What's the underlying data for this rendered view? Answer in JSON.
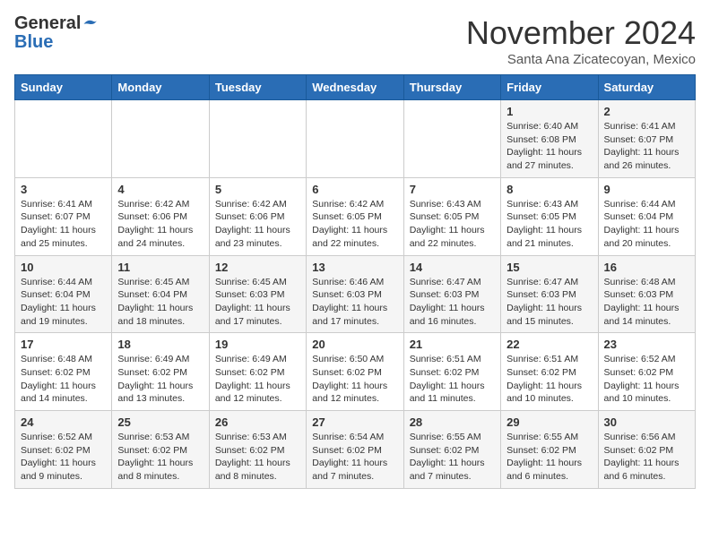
{
  "header": {
    "logo_general": "General",
    "logo_blue": "Blue",
    "month_title": "November 2024",
    "subtitle": "Santa Ana Zicatecoyan, Mexico"
  },
  "days_of_week": [
    "Sunday",
    "Monday",
    "Tuesday",
    "Wednesday",
    "Thursday",
    "Friday",
    "Saturday"
  ],
  "weeks": [
    [
      {
        "day": "",
        "info": ""
      },
      {
        "day": "",
        "info": ""
      },
      {
        "day": "",
        "info": ""
      },
      {
        "day": "",
        "info": ""
      },
      {
        "day": "",
        "info": ""
      },
      {
        "day": "1",
        "info": "Sunrise: 6:40 AM\nSunset: 6:08 PM\nDaylight: 11 hours and 27 minutes."
      },
      {
        "day": "2",
        "info": "Sunrise: 6:41 AM\nSunset: 6:07 PM\nDaylight: 11 hours and 26 minutes."
      }
    ],
    [
      {
        "day": "3",
        "info": "Sunrise: 6:41 AM\nSunset: 6:07 PM\nDaylight: 11 hours and 25 minutes."
      },
      {
        "day": "4",
        "info": "Sunrise: 6:42 AM\nSunset: 6:06 PM\nDaylight: 11 hours and 24 minutes."
      },
      {
        "day": "5",
        "info": "Sunrise: 6:42 AM\nSunset: 6:06 PM\nDaylight: 11 hours and 23 minutes."
      },
      {
        "day": "6",
        "info": "Sunrise: 6:42 AM\nSunset: 6:05 PM\nDaylight: 11 hours and 22 minutes."
      },
      {
        "day": "7",
        "info": "Sunrise: 6:43 AM\nSunset: 6:05 PM\nDaylight: 11 hours and 22 minutes."
      },
      {
        "day": "8",
        "info": "Sunrise: 6:43 AM\nSunset: 6:05 PM\nDaylight: 11 hours and 21 minutes."
      },
      {
        "day": "9",
        "info": "Sunrise: 6:44 AM\nSunset: 6:04 PM\nDaylight: 11 hours and 20 minutes."
      }
    ],
    [
      {
        "day": "10",
        "info": "Sunrise: 6:44 AM\nSunset: 6:04 PM\nDaylight: 11 hours and 19 minutes."
      },
      {
        "day": "11",
        "info": "Sunrise: 6:45 AM\nSunset: 6:04 PM\nDaylight: 11 hours and 18 minutes."
      },
      {
        "day": "12",
        "info": "Sunrise: 6:45 AM\nSunset: 6:03 PM\nDaylight: 11 hours and 17 minutes."
      },
      {
        "day": "13",
        "info": "Sunrise: 6:46 AM\nSunset: 6:03 PM\nDaylight: 11 hours and 17 minutes."
      },
      {
        "day": "14",
        "info": "Sunrise: 6:47 AM\nSunset: 6:03 PM\nDaylight: 11 hours and 16 minutes."
      },
      {
        "day": "15",
        "info": "Sunrise: 6:47 AM\nSunset: 6:03 PM\nDaylight: 11 hours and 15 minutes."
      },
      {
        "day": "16",
        "info": "Sunrise: 6:48 AM\nSunset: 6:03 PM\nDaylight: 11 hours and 14 minutes."
      }
    ],
    [
      {
        "day": "17",
        "info": "Sunrise: 6:48 AM\nSunset: 6:02 PM\nDaylight: 11 hours and 14 minutes."
      },
      {
        "day": "18",
        "info": "Sunrise: 6:49 AM\nSunset: 6:02 PM\nDaylight: 11 hours and 13 minutes."
      },
      {
        "day": "19",
        "info": "Sunrise: 6:49 AM\nSunset: 6:02 PM\nDaylight: 11 hours and 12 minutes."
      },
      {
        "day": "20",
        "info": "Sunrise: 6:50 AM\nSunset: 6:02 PM\nDaylight: 11 hours and 12 minutes."
      },
      {
        "day": "21",
        "info": "Sunrise: 6:51 AM\nSunset: 6:02 PM\nDaylight: 11 hours and 11 minutes."
      },
      {
        "day": "22",
        "info": "Sunrise: 6:51 AM\nSunset: 6:02 PM\nDaylight: 11 hours and 10 minutes."
      },
      {
        "day": "23",
        "info": "Sunrise: 6:52 AM\nSunset: 6:02 PM\nDaylight: 11 hours and 10 minutes."
      }
    ],
    [
      {
        "day": "24",
        "info": "Sunrise: 6:52 AM\nSunset: 6:02 PM\nDaylight: 11 hours and 9 minutes."
      },
      {
        "day": "25",
        "info": "Sunrise: 6:53 AM\nSunset: 6:02 PM\nDaylight: 11 hours and 8 minutes."
      },
      {
        "day": "26",
        "info": "Sunrise: 6:53 AM\nSunset: 6:02 PM\nDaylight: 11 hours and 8 minutes."
      },
      {
        "day": "27",
        "info": "Sunrise: 6:54 AM\nSunset: 6:02 PM\nDaylight: 11 hours and 7 minutes."
      },
      {
        "day": "28",
        "info": "Sunrise: 6:55 AM\nSunset: 6:02 PM\nDaylight: 11 hours and 7 minutes."
      },
      {
        "day": "29",
        "info": "Sunrise: 6:55 AM\nSunset: 6:02 PM\nDaylight: 11 hours and 6 minutes."
      },
      {
        "day": "30",
        "info": "Sunrise: 6:56 AM\nSunset: 6:02 PM\nDaylight: 11 hours and 6 minutes."
      }
    ]
  ]
}
